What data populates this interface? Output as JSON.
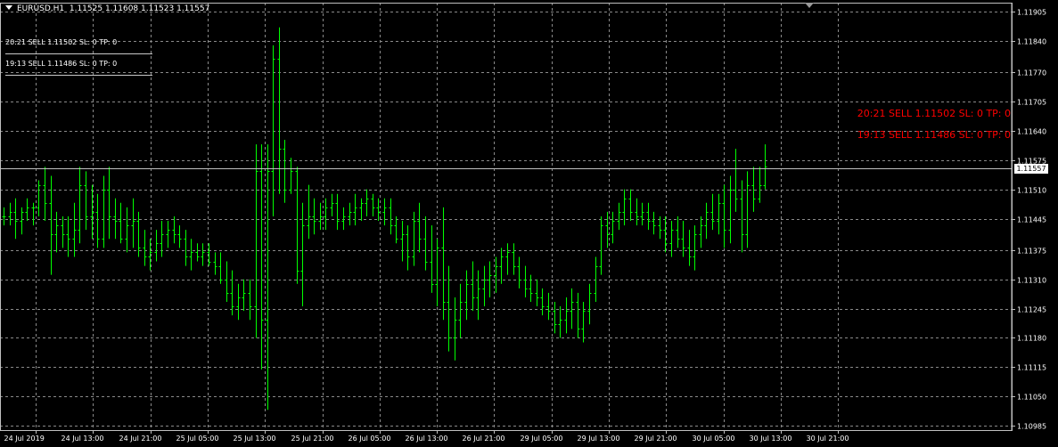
{
  "header": {
    "symbol": "EURUSD,H1",
    "ohlc": "1.11525 1.11608 1.11523 1.11557"
  },
  "order_notes": [
    {
      "text": "20:21 SELL 1.11502 SL: 0 TP: 0"
    },
    {
      "text": "19:13 SELL 1.11486 SL: 0 TP: 0"
    }
  ],
  "red_notes": [
    {
      "text": "20:21 SELL 1.11502 SL: 0 TP: 0"
    },
    {
      "text": "19:13 SELL 1.11486 SL: 0 TP: 0"
    }
  ],
  "current_price": "1.11557",
  "colors": {
    "bars": "#00ff00",
    "grid": "#8a8a8a",
    "axis": "#c0c0c0",
    "price_line": "#c0c0c0",
    "text": "#ffffff",
    "red_text": "#ff0000"
  },
  "chart_data": {
    "type": "ohlc_bar",
    "price_ticks": [
      "1.11905",
      "1.11840",
      "1.11770",
      "1.11705",
      "1.11640",
      "1.11575",
      "1.11510",
      "1.11445",
      "1.11375",
      "1.11310",
      "1.11245",
      "1.11180",
      "1.11115",
      "1.11050",
      "1.10985"
    ],
    "time_ticks": [
      "24 Jul 2019",
      "24 Jul 13:00",
      "24 Jul 21:00",
      "25 Jul 05:00",
      "25 Jul 13:00",
      "25 Jul 21:00",
      "26 Jul 05:00",
      "26 Jul 13:00",
      "26 Jul 21:00",
      "29 Jul 05:00",
      "29 Jul 13:00",
      "29 Jul 21:00",
      "30 Jul 05:00",
      "30 Jul 13:00",
      "30 Jul 21:00"
    ],
    "ylim": [
      1.10985,
      1.11905
    ],
    "grid": true,
    "bars": [
      [
        1.1145,
        1.1147,
        1.1143,
        1.1145
      ],
      [
        1.1145,
        1.1148,
        1.1143,
        1.1146
      ],
      [
        1.1146,
        1.1149,
        1.114,
        1.1144
      ],
      [
        1.1144,
        1.1147,
        1.1141,
        1.1146
      ],
      [
        1.1146,
        1.1149,
        1.1144,
        1.1147
      ],
      [
        1.1147,
        1.1148,
        1.1143,
        1.1147
      ],
      [
        1.1147,
        1.1153,
        1.1145,
        1.1152
      ],
      [
        1.1152,
        1.1156,
        1.1144,
        1.1148
      ],
      [
        1.1148,
        1.1154,
        1.1132,
        1.1141
      ],
      [
        1.1141,
        1.1146,
        1.1137,
        1.1143
      ],
      [
        1.1143,
        1.1145,
        1.1138,
        1.1141
      ],
      [
        1.1141,
        1.1145,
        1.1136,
        1.114
      ],
      [
        1.114,
        1.1148,
        1.1136,
        1.1142
      ],
      [
        1.1142,
        1.1156,
        1.1139,
        1.1152
      ],
      [
        1.1152,
        1.1155,
        1.1142,
        1.1145
      ],
      [
        1.1145,
        1.1152,
        1.114,
        1.1146
      ],
      [
        1.1146,
        1.115,
        1.1138,
        1.114
      ],
      [
        1.114,
        1.1154,
        1.1138,
        1.1151
      ],
      [
        1.1151,
        1.1156,
        1.114,
        1.1145
      ],
      [
        1.1145,
        1.1149,
        1.114,
        1.1144
      ],
      [
        1.1144,
        1.1148,
        1.1139,
        1.114
      ],
      [
        1.114,
        1.1147,
        1.1137,
        1.1143
      ],
      [
        1.1143,
        1.1149,
        1.1138,
        1.1144
      ],
      [
        1.1144,
        1.1146,
        1.1136,
        1.1138
      ],
      [
        1.1138,
        1.1142,
        1.1134,
        1.1136
      ],
      [
        1.1136,
        1.114,
        1.1133,
        1.1137
      ],
      [
        1.1137,
        1.1142,
        1.1135,
        1.1139
      ],
      [
        1.1139,
        1.1144,
        1.1136,
        1.1141
      ],
      [
        1.1141,
        1.1144,
        1.1138,
        1.1142
      ],
      [
        1.1142,
        1.1145,
        1.1139,
        1.1141
      ],
      [
        1.1141,
        1.1143,
        1.1138,
        1.114
      ],
      [
        1.114,
        1.1142,
        1.1134,
        1.1136
      ],
      [
        1.1136,
        1.114,
        1.1133,
        1.1137
      ],
      [
        1.1137,
        1.1139,
        1.1135,
        1.1136
      ],
      [
        1.1136,
        1.1139,
        1.1134,
        1.1137
      ],
      [
        1.1137,
        1.1139,
        1.1134,
        1.1135
      ],
      [
        1.1135,
        1.1137,
        1.1132,
        1.1134
      ],
      [
        1.1134,
        1.1137,
        1.113,
        1.1131
      ],
      [
        1.1131,
        1.1135,
        1.1126,
        1.1128
      ],
      [
        1.1128,
        1.1133,
        1.1123,
        1.1125
      ],
      [
        1.1125,
        1.113,
        1.1122,
        1.1127
      ],
      [
        1.1127,
        1.1131,
        1.1124,
        1.1128
      ],
      [
        1.1128,
        1.1131,
        1.1122,
        1.1125
      ],
      [
        1.1125,
        1.1161,
        1.1118,
        1.1155
      ],
      [
        1.1155,
        1.1161,
        1.1111,
        1.1122
      ],
      [
        1.1122,
        1.1161,
        1.1102,
        1.1155
      ],
      [
        1.1155,
        1.1183,
        1.1145,
        1.118
      ],
      [
        1.118,
        1.1187,
        1.115,
        1.116
      ],
      [
        1.116,
        1.1162,
        1.1148,
        1.1151
      ],
      [
        1.1151,
        1.1158,
        1.115,
        1.1155
      ],
      [
        1.1155,
        1.1156,
        1.113,
        1.1133
      ],
      [
        1.1133,
        1.1148,
        1.1125,
        1.1143
      ],
      [
        1.1143,
        1.1152,
        1.114,
        1.1145
      ],
      [
        1.1145,
        1.1149,
        1.1141,
        1.1144
      ],
      [
        1.1144,
        1.1148,
        1.1142,
        1.1145
      ],
      [
        1.1145,
        1.1149,
        1.1142,
        1.1147
      ],
      [
        1.1147,
        1.115,
        1.1145,
        1.1148
      ],
      [
        1.1148,
        1.115,
        1.1142,
        1.1144
      ],
      [
        1.1144,
        1.1147,
        1.1142,
        1.1145
      ],
      [
        1.1145,
        1.1148,
        1.1143,
        1.1146
      ],
      [
        1.1146,
        1.115,
        1.1143,
        1.1147
      ],
      [
        1.1147,
        1.1149,
        1.1144,
        1.1148
      ],
      [
        1.1148,
        1.1151,
        1.1145,
        1.1149
      ],
      [
        1.1149,
        1.115,
        1.1145,
        1.1147
      ],
      [
        1.1147,
        1.1149,
        1.1144,
        1.1146
      ],
      [
        1.1146,
        1.1149,
        1.1143,
        1.1147
      ],
      [
        1.1147,
        1.1149,
        1.1141,
        1.1143
      ],
      [
        1.1143,
        1.1145,
        1.1139,
        1.114
      ],
      [
        1.114,
        1.1144,
        1.1135,
        1.1141
      ],
      [
        1.1141,
        1.1143,
        1.1133,
        1.1136
      ],
      [
        1.1136,
        1.1146,
        1.1134,
        1.1144
      ],
      [
        1.1144,
        1.1148,
        1.1137,
        1.114
      ],
      [
        1.114,
        1.1145,
        1.1133,
        1.1135
      ],
      [
        1.1135,
        1.1143,
        1.1128,
        1.113
      ],
      [
        1.113,
        1.114,
        1.1125,
        1.1138
      ],
      [
        1.1138,
        1.1147,
        1.1122,
        1.1126
      ],
      [
        1.1126,
        1.1134,
        1.1115,
        1.1118
      ],
      [
        1.1118,
        1.1127,
        1.1113,
        1.1122
      ],
      [
        1.1122,
        1.113,
        1.1118,
        1.1126
      ],
      [
        1.1126,
        1.1133,
        1.1122,
        1.113
      ],
      [
        1.113,
        1.1135,
        1.1124,
        1.1127
      ],
      [
        1.1127,
        1.1133,
        1.1122,
        1.1129
      ],
      [
        1.1129,
        1.1134,
        1.1125,
        1.1131
      ],
      [
        1.1131,
        1.1135,
        1.1127,
        1.1132
      ],
      [
        1.1132,
        1.1136,
        1.1128,
        1.1134
      ],
      [
        1.1134,
        1.1138,
        1.113,
        1.1136
      ],
      [
        1.1136,
        1.1139,
        1.1132,
        1.1137
      ],
      [
        1.1137,
        1.1139,
        1.1132,
        1.1134
      ],
      [
        1.1134,
        1.1136,
        1.1129,
        1.1131
      ],
      [
        1.1131,
        1.1134,
        1.1127,
        1.1129
      ],
      [
        1.1129,
        1.1132,
        1.1126,
        1.1128
      ],
      [
        1.1128,
        1.1131,
        1.1125,
        1.1127
      ],
      [
        1.1127,
        1.1129,
        1.1123,
        1.1125
      ],
      [
        1.1125,
        1.1128,
        1.1122,
        1.1124
      ],
      [
        1.1124,
        1.1126,
        1.1119,
        1.1121
      ],
      [
        1.1121,
        1.1125,
        1.1118,
        1.1122
      ],
      [
        1.1122,
        1.1127,
        1.1119,
        1.1124
      ],
      [
        1.1124,
        1.1129,
        1.112,
        1.1126
      ],
      [
        1.1126,
        1.1128,
        1.1118,
        1.112
      ],
      [
        1.112,
        1.1126,
        1.1117,
        1.1124
      ],
      [
        1.1124,
        1.113,
        1.1121,
        1.1128
      ],
      [
        1.1128,
        1.1136,
        1.1126,
        1.1134
      ],
      [
        1.1134,
        1.1145,
        1.1132,
        1.1143
      ],
      [
        1.1143,
        1.1146,
        1.1138,
        1.1141
      ],
      [
        1.1141,
        1.1146,
        1.1139,
        1.1144
      ],
      [
        1.1144,
        1.1148,
        1.1142,
        1.1146
      ],
      [
        1.1146,
        1.1151,
        1.1143,
        1.1149
      ],
      [
        1.1149,
        1.1151,
        1.1144,
        1.1146
      ],
      [
        1.1146,
        1.1149,
        1.1143,
        1.1145
      ],
      [
        1.1145,
        1.1148,
        1.1143,
        1.1146
      ],
      [
        1.1146,
        1.1148,
        1.1142,
        1.1144
      ],
      [
        1.1144,
        1.1146,
        1.1141,
        1.1143
      ],
      [
        1.1143,
        1.1145,
        1.114,
        1.1142
      ],
      [
        1.1142,
        1.1145,
        1.1137,
        1.1139
      ],
      [
        1.1139,
        1.1144,
        1.1136,
        1.1142
      ],
      [
        1.1142,
        1.1145,
        1.1138,
        1.114
      ],
      [
        1.114,
        1.1144,
        1.1136,
        1.1138
      ],
      [
        1.1138,
        1.1142,
        1.1134,
        1.1136
      ],
      [
        1.1136,
        1.1143,
        1.1133,
        1.1141
      ],
      [
        1.1141,
        1.1145,
        1.1138,
        1.1143
      ],
      [
        1.1143,
        1.1148,
        1.114,
        1.1146
      ],
      [
        1.1146,
        1.115,
        1.1142,
        1.1144
      ],
      [
        1.1144,
        1.115,
        1.1141,
        1.1148
      ],
      [
        1.1148,
        1.1152,
        1.1138,
        1.1142
      ],
      [
        1.1142,
        1.1154,
        1.1139,
        1.1151
      ],
      [
        1.1151,
        1.116,
        1.1146,
        1.1149
      ],
      [
        1.1149,
        1.1153,
        1.1137,
        1.1141
      ],
      [
        1.1141,
        1.1155,
        1.1138,
        1.1152
      ],
      [
        1.1152,
        1.1156,
        1.1146,
        1.1149
      ],
      [
        1.1149,
        1.1156,
        1.1148,
        1.1152
      ],
      [
        1.1152,
        1.1161,
        1.1151,
        1.1156
      ]
    ]
  }
}
